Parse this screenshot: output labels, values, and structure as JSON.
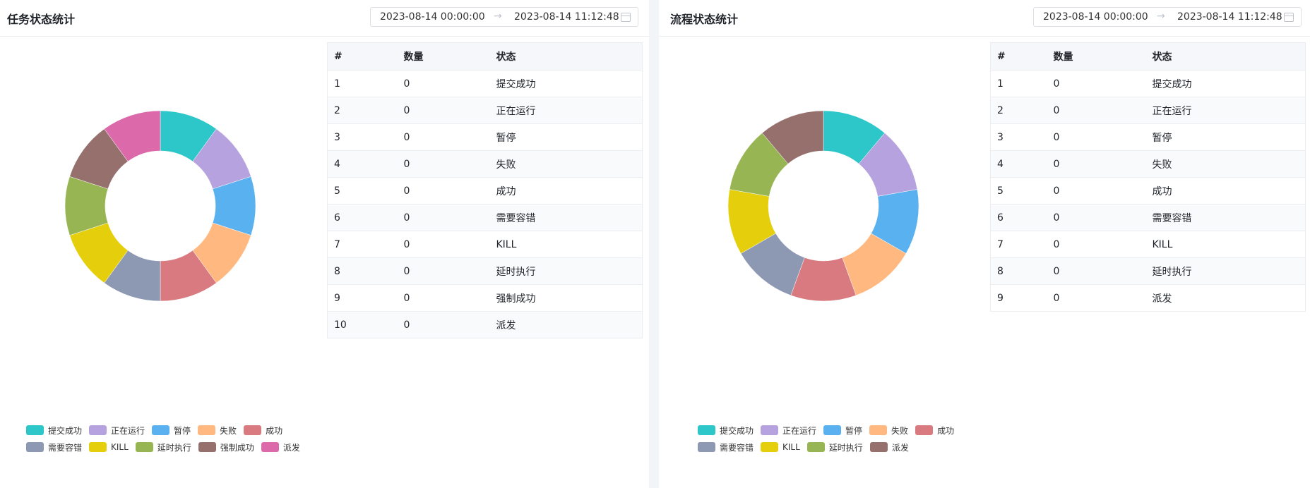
{
  "task_panel": {
    "title": "任务状态统计",
    "date_start": "2023-08-14 00:00:00",
    "date_end": "2023-08-14 11:12:48",
    "table_headers": [
      "#",
      "数量",
      "状态"
    ],
    "rows": [
      {
        "index": "1",
        "count": "0",
        "status": "提交成功"
      },
      {
        "index": "2",
        "count": "0",
        "status": "正在运行"
      },
      {
        "index": "3",
        "count": "0",
        "status": "暂停"
      },
      {
        "index": "4",
        "count": "0",
        "status": "失败"
      },
      {
        "index": "5",
        "count": "0",
        "status": "成功"
      },
      {
        "index": "6",
        "count": "0",
        "status": "需要容错"
      },
      {
        "index": "7",
        "count": "0",
        "status": "KILL"
      },
      {
        "index": "8",
        "count": "0",
        "status": "延时执行"
      },
      {
        "index": "9",
        "count": "0",
        "status": "强制成功"
      },
      {
        "index": "10",
        "count": "0",
        "status": "派发"
      }
    ]
  },
  "process_panel": {
    "title": "流程状态统计",
    "date_start": "2023-08-14 00:00:00",
    "date_end": "2023-08-14 11:12:48",
    "table_headers": [
      "#",
      "数量",
      "状态"
    ],
    "rows": [
      {
        "index": "1",
        "count": "0",
        "status": "提交成功"
      },
      {
        "index": "2",
        "count": "0",
        "status": "正在运行"
      },
      {
        "index": "3",
        "count": "0",
        "status": "暂停"
      },
      {
        "index": "4",
        "count": "0",
        "status": "失败"
      },
      {
        "index": "5",
        "count": "0",
        "status": "成功"
      },
      {
        "index": "6",
        "count": "0",
        "status": "需要容错"
      },
      {
        "index": "7",
        "count": "0",
        "status": "KILL"
      },
      {
        "index": "8",
        "count": "0",
        "status": "延时执行"
      },
      {
        "index": "9",
        "count": "0",
        "status": "派发"
      }
    ]
  },
  "chart_data": [
    {
      "type": "pie",
      "categories": [
        "提交成功",
        "正在运行",
        "暂停",
        "失败",
        "成功",
        "需要容错",
        "KILL",
        "延时执行",
        "强制成功",
        "派发"
      ],
      "values": [
        0,
        0,
        0,
        0,
        0,
        0,
        0,
        0,
        0,
        0
      ],
      "colors": [
        "#2ec7c9",
        "#b6a2de",
        "#5ab1ef",
        "#ffb980",
        "#d87a80",
        "#8d98b3",
        "#e5cf0d",
        "#97b552",
        "#95706d",
        "#dc69aa"
      ],
      "legend": "bottom-left",
      "note_render": "donut"
    },
    {
      "type": "pie",
      "categories": [
        "提交成功",
        "正在运行",
        "暂停",
        "失败",
        "成功",
        "需要容错",
        "KILL",
        "延时执行",
        "派发"
      ],
      "values": [
        0,
        0,
        0,
        0,
        0,
        0,
        0,
        0,
        0
      ],
      "colors": [
        "#2ec7c9",
        "#b6a2de",
        "#5ab1ef",
        "#ffb980",
        "#d87a80",
        "#8d98b3",
        "#e5cf0d",
        "#97b552",
        "#95706d"
      ],
      "legend": "bottom-left",
      "note_render": "donut"
    }
  ]
}
